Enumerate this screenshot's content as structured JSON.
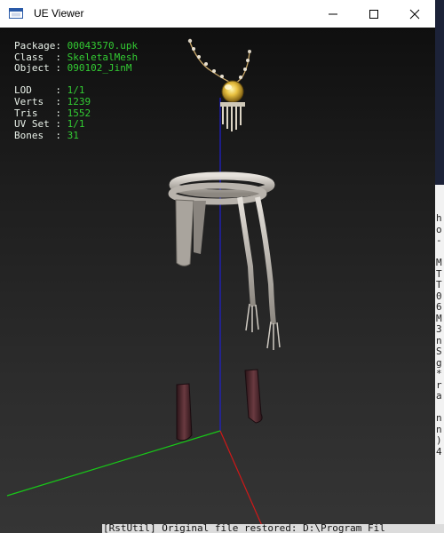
{
  "window": {
    "title": "UE Viewer",
    "controls": {
      "minimize": "minimize-icon",
      "maximize": "maximize-icon",
      "close": "close-icon"
    }
  },
  "info": {
    "package_label": "Package: ",
    "package": "00043570.upk",
    "class_label": "Class  : ",
    "class": "SkeletalMesh",
    "object_label": "Object : ",
    "object": "090102_JinM",
    "lod_label": "LOD    : ",
    "lod": "1/1",
    "verts_label": "Verts  : ",
    "verts": "1239",
    "tris_label": "Tris   : ",
    "tris": "1552",
    "uvset_label": "UV Set : ",
    "uvset": "1/1",
    "bones_label": "Bones  : ",
    "bones": "31"
  },
  "console": {
    "lines": [
      "h",
      "o",
      "-",
      "",
      "M",
      "T",
      "T",
      "0",
      "6",
      "M",
      "3",
      "n",
      "S",
      "g",
      "*",
      "r",
      "a",
      "",
      "n",
      "n",
      ")",
      "4"
    ],
    "status": "[RstUtil] Original file restored: D:\\Program Fil"
  },
  "desktop_glyph": "M",
  "colors": {
    "axis_x": "#d01818",
    "axis_y": "#18c818",
    "axis_z": "#2020d0",
    "info_value": "#33cc33"
  }
}
